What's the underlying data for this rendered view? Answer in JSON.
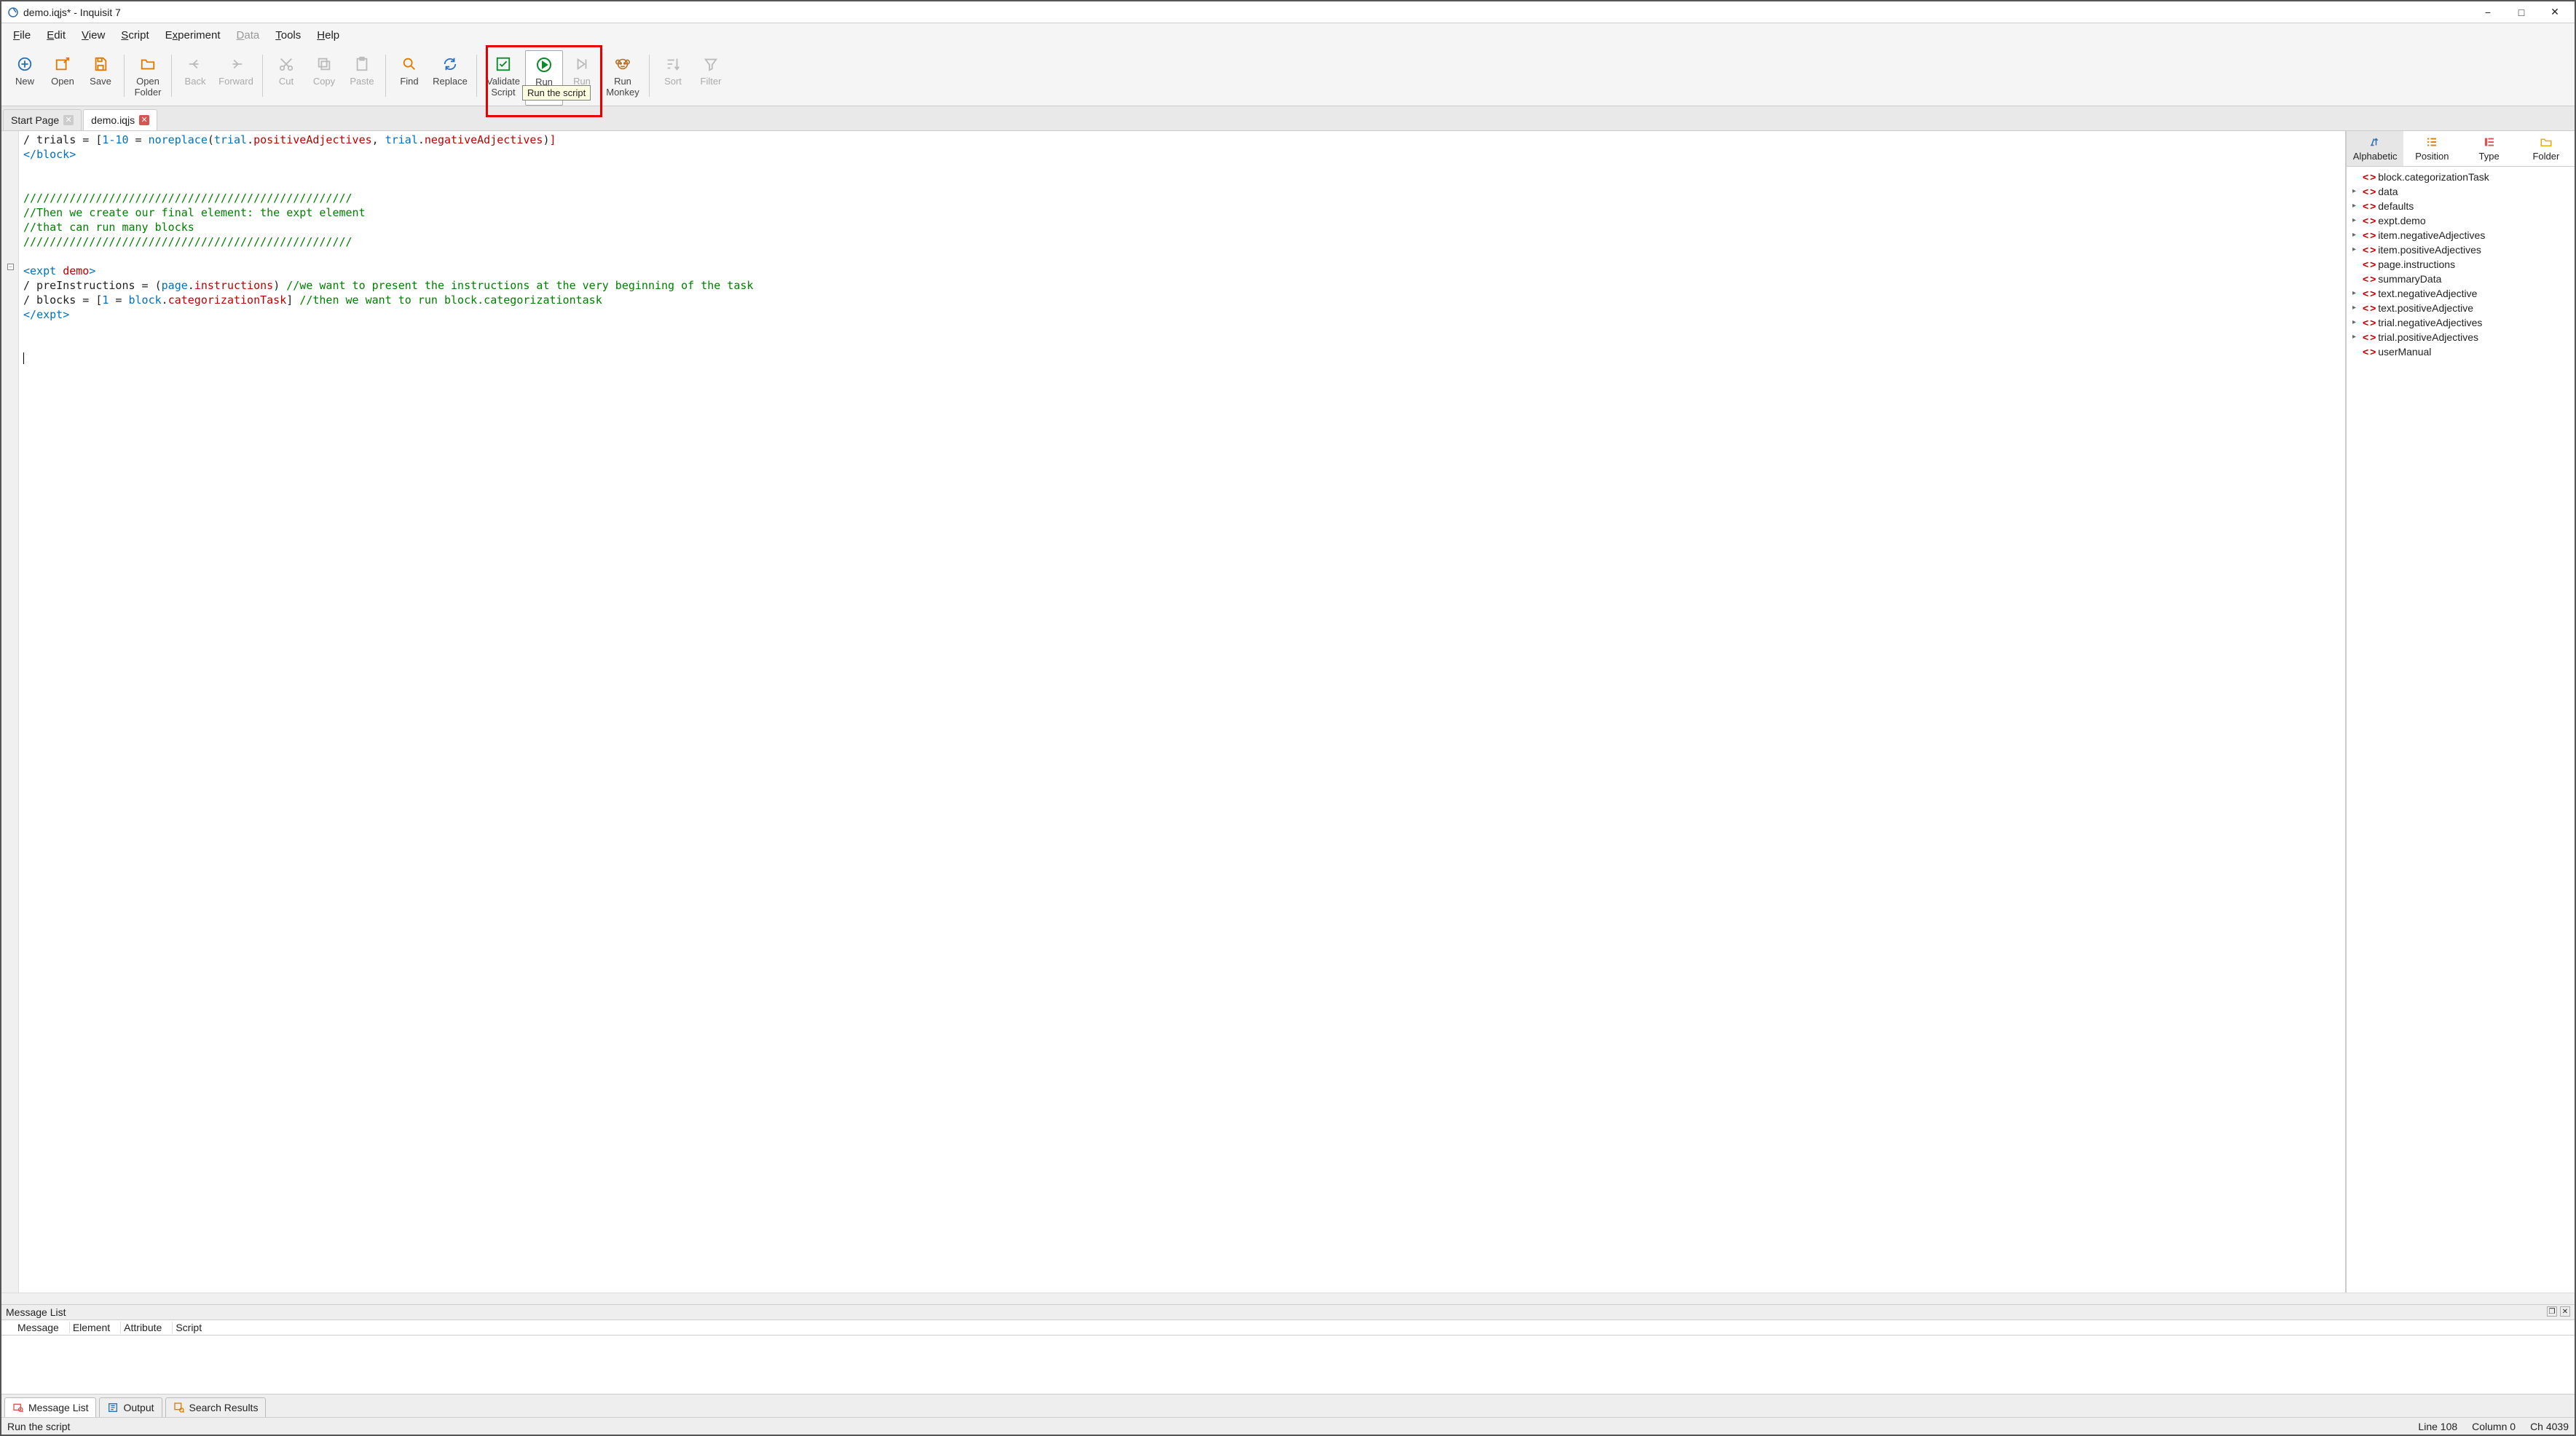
{
  "window": {
    "title": "demo.iqjs* - Inquisit 7"
  },
  "menu": {
    "file": "File",
    "edit": "Edit",
    "view": "View",
    "script": "Script",
    "experiment": "Experiment",
    "data": "Data",
    "tools": "Tools",
    "help": "Help"
  },
  "toolbar": {
    "new": "New",
    "open": "Open",
    "save": "Save",
    "openFolder": "Open\nFolder",
    "back": "Back",
    "forward": "Forward",
    "cut": "Cut",
    "copy": "Copy",
    "paste": "Paste",
    "find": "Find",
    "replace": "Replace",
    "validate": "Validate\nScript",
    "run": "Run",
    "runStep": "Run",
    "runMonkey": "Run\nMonkey",
    "sort": "Sort",
    "filter": "Filter"
  },
  "tooltip": "Run the script",
  "docTabs": {
    "start": "Start Page",
    "demo": "demo.iqjs"
  },
  "code": {
    "l1_a": "/ trials = [",
    "l1_b": "1-10",
    "l1_c": " = ",
    "l1_d": "noreplace",
    "l1_e": "(",
    "l1_f": "trial",
    "l1_g": ".",
    "l1_h": "positiveAdjectives",
    "l1_i": ", ",
    "l1_j": "trial",
    "l1_k": ".",
    "l1_l": "negativeAdjectives",
    "l1_m": ")",
    "l1_n": "]",
    "l2": "</",
    "l2b": "block",
    "l2c": ">",
    "l4": "//////////////////////////////////////////////////",
    "l5": "//Then we create our final element: the expt element",
    "l6": "//that can run many blocks",
    "l7": "//////////////////////////////////////////////////",
    "l9a": "<",
    "l9b": "expt",
    "l9c": " ",
    "l9d": "demo",
    "l9e": ">",
    "l10a": "/ preInstructions = (",
    "l10b": "page",
    "l10c": ".",
    "l10d": "instructions",
    "l10e": ") ",
    "l10f": "//we want to present the instructions at the very beginning of the task",
    "l11a": "/ blocks = [",
    "l11b": "1",
    "l11c": " = ",
    "l11d": "block",
    "l11e": ".",
    "l11f": "categorizationTask",
    "l11g": "] ",
    "l11h": "//then we want to run block.categorizationtask",
    "l12a": "</",
    "l12b": "expt",
    "l12c": ">"
  },
  "views": {
    "alphabetic": "Alphabetic",
    "position": "Position",
    "type": "Type",
    "folder": "Folder"
  },
  "tree": [
    {
      "expand": "",
      "label": "block.categorizationTask"
    },
    {
      "expand": "▸",
      "label": "data"
    },
    {
      "expand": "▸",
      "label": "defaults"
    },
    {
      "expand": "▸",
      "label": "expt.demo"
    },
    {
      "expand": "▸",
      "label": "item.negativeAdjectives"
    },
    {
      "expand": "▸",
      "label": "item.positiveAdjectives"
    },
    {
      "expand": "",
      "label": "page.instructions"
    },
    {
      "expand": "",
      "label": "summaryData"
    },
    {
      "expand": "▸",
      "label": "text.negativeAdjective"
    },
    {
      "expand": "▸",
      "label": "text.positiveAdjective"
    },
    {
      "expand": "▸",
      "label": "trial.negativeAdjectives"
    },
    {
      "expand": "▸",
      "label": "trial.positiveAdjectives"
    },
    {
      "expand": "",
      "label": "userManual"
    }
  ],
  "msgPane": {
    "title": "Message List",
    "cols": {
      "message": "Message",
      "element": "Element",
      "attribute": "Attribute",
      "script": "Script"
    }
  },
  "bottomTabs": {
    "messageList": "Message List",
    "output": "Output",
    "searchResults": "Search Results"
  },
  "status": {
    "left": "Run the script",
    "line": "Line  108",
    "column": "Column  0",
    "ch": "Ch  4039"
  }
}
